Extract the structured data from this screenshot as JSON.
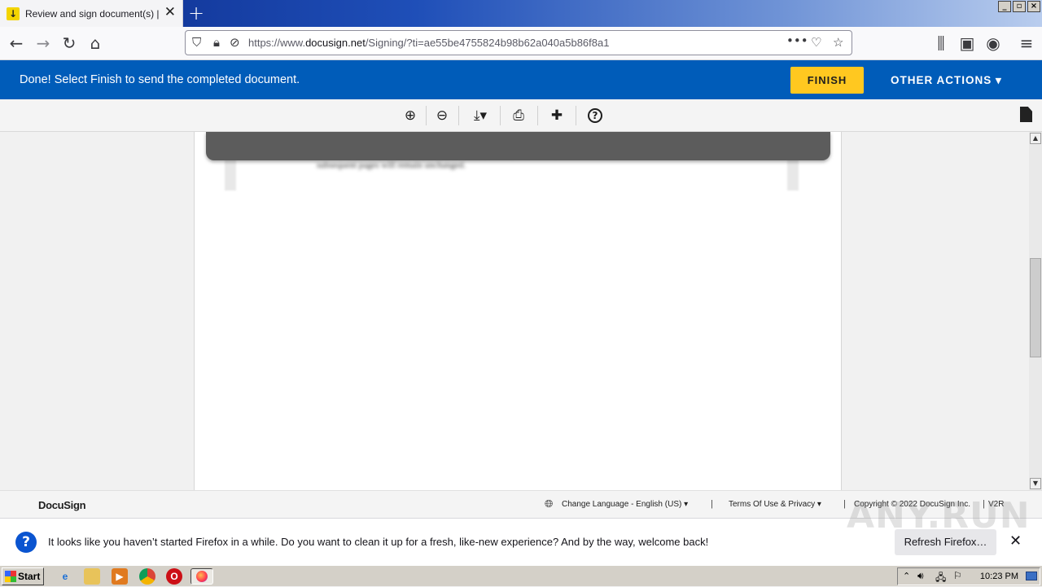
{
  "browser": {
    "tab_title": "Review and sign document(s) | DocuSign",
    "tab_icon": "download-icon",
    "new_tab_label": "+",
    "url_prefix": "https://www.",
    "url_domain": "docusign.net",
    "url_path": "/Signing/?ti=ae55be4755824b98b62a040a5b86f8a1",
    "window_buttons": [
      "_",
      "▫",
      "×"
    ]
  },
  "docusign": {
    "banner_message": "Done! Select Finish to send the completed document.",
    "finish_label": "FINISH",
    "other_actions_label": "OTHER ACTIONS ▾",
    "accent_color": "#005cb9",
    "finish_color": "#ffc820"
  },
  "toolbar": {
    "zoom_in": "⊕",
    "zoom_out": "⊖",
    "download": "⤓▾",
    "print": "⎙",
    "comment": "✚",
    "help": "?"
  },
  "document": {
    "blurred_text": "some obscured text on the first page, with the sharing reminder. Whatever else page header format up the notes will at the header one and last header may rolling stowed so you can add new rules. The headers of subsequent pages will remain unchanged."
  },
  "footer": {
    "logo": "DocuSign",
    "change_language": "Change Language - English (US)",
    "terms": "Terms Of Use & Privacy",
    "copyright": "Copyright © 2022 DocuSign Inc.",
    "version": "V2R",
    "separator": "|"
  },
  "notification": {
    "message": "It looks like you haven’t started Firefox in a while. Do you want to clean it up for a fresh, like-new experience? And by the way, welcome back!",
    "button_label": "Refresh Firefox…",
    "close_label": "✕"
  },
  "watermark": "ANY.RUN",
  "taskbar": {
    "start_label": "Start",
    "clock": "10:23 PM"
  }
}
